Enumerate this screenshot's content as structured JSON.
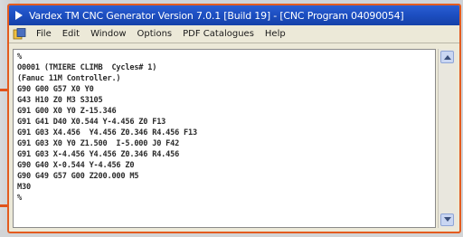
{
  "window": {
    "title": "Vardex TM CNC Generator Version 7.0.1 [Build 19] - [CNC Program 04090054]"
  },
  "menu": {
    "items": [
      "File",
      "Edit",
      "Window",
      "Options",
      "PDF Catalogues",
      "Help"
    ]
  },
  "editor": {
    "lines": [
      "%",
      "O0001 (TMIERE CLIMB  Cycles# 1)",
      "(Fanuc 11M Controller.)",
      "G90 G00 G57 X0 Y0",
      "G43 H10 Z0 M3 S3105",
      "G91 G00 X0 Y0 Z-15.346",
      "G91 G41 D40 X0.544 Y-4.456 Z0 F13",
      "G91 G03 X4.456  Y4.456 Z0.346 R4.456 F13",
      "G91 G03 X0 Y0 Z1.500  I-5.000 J0 F42",
      "G91 G03 X-4.456 Y4.456 Z0.346 R4.456",
      "G90 G40 X-0.544 Y-4.456 Z0",
      "G90 G49 G57 G00 Z200.000 M5",
      "M30",
      "%"
    ]
  },
  "colors": {
    "title_bar": "#1d4fc2",
    "frame_border": "#e35b1f",
    "menu_bg": "#ece9d8",
    "editor_bg": "#ffffff"
  },
  "icons": {
    "app": "app-logo-icon",
    "menu_doc": "document-icon",
    "scroll_up": "scroll-up-arrow-icon",
    "scroll_down": "scroll-down-arrow-icon"
  }
}
